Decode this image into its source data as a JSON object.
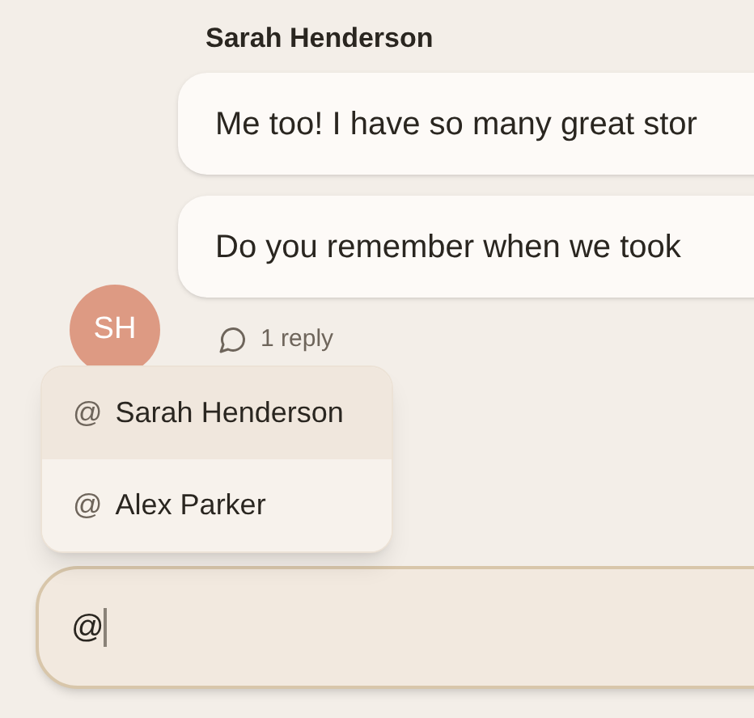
{
  "message_group": {
    "sender": "Sarah Henderson",
    "avatar_initials": "SH",
    "messages": [
      "Me too! I have so many great stor",
      "Do you remember when we took"
    ],
    "reply_count": "1 reply"
  },
  "mention_menu": {
    "items": [
      {
        "prefix": "@",
        "name": "Sarah Henderson",
        "selected": true
      },
      {
        "prefix": "@",
        "name": "Alex Parker",
        "selected": false
      }
    ]
  },
  "composer": {
    "value": "@"
  }
}
